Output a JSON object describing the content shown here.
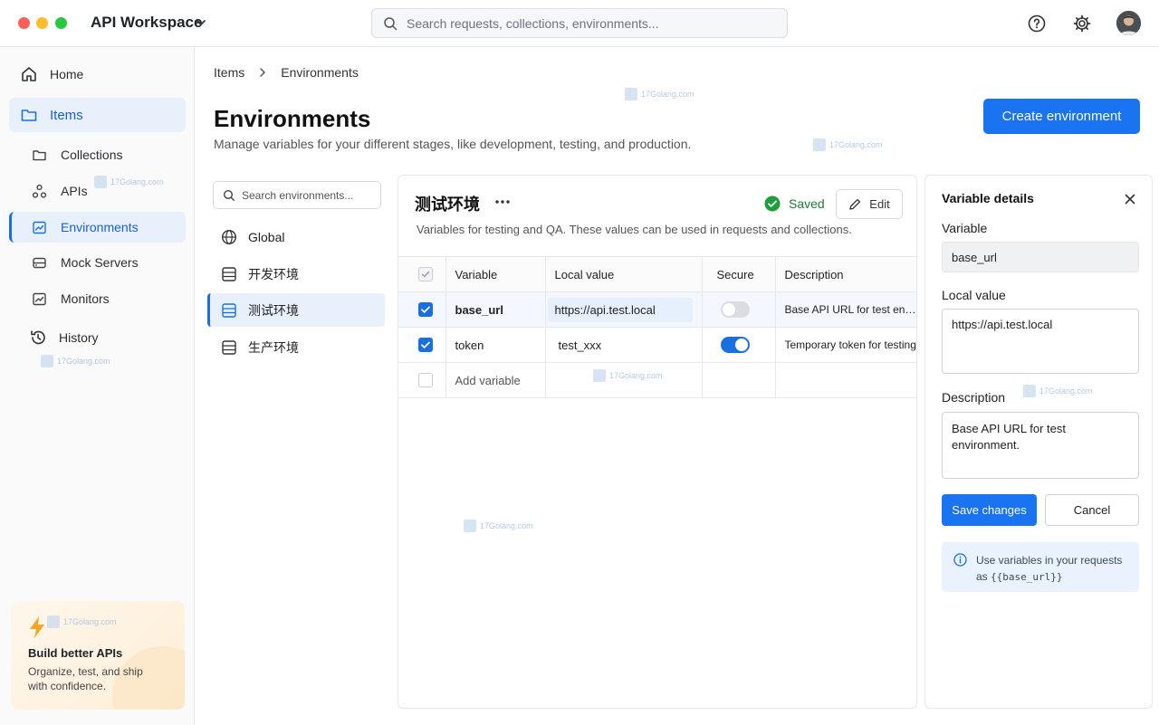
{
  "topbar": {
    "workspace_title": "API Workspace",
    "search_placeholder": "Search requests, collections, environments..."
  },
  "sidebar": {
    "home": "Home",
    "items": "Items",
    "sub_items": [
      "Collections",
      "APIs",
      "Environments",
      "Mock Servers",
      "Monitors"
    ],
    "history": "History",
    "promo": {
      "title": "Build better APIs",
      "text": "Organize, test, and ship with confidence."
    }
  },
  "breadcrumb": [
    "Items",
    "Environments"
  ],
  "page": {
    "title": "Environments",
    "subtitle": "Manage variables for your different stages, like development, testing, and production.",
    "create_button": "Create environment"
  },
  "env_list": {
    "search_placeholder": "Search environments...",
    "items": [
      "Global",
      "开发环境",
      "测试环境",
      "生产环境"
    ],
    "active_index": 2
  },
  "env_card": {
    "name": "测试环境",
    "status": "Saved",
    "edit_label": "Edit",
    "description": "Variables for testing and QA. These values can be used in requests and collections.",
    "columns": [
      "Variable",
      "Local value",
      "Secure",
      "Description"
    ],
    "rows": [
      {
        "checked": true,
        "variable": "base_url",
        "value": "https://api.test.local",
        "secure": false,
        "description": "Base API URL for test environment."
      },
      {
        "checked": true,
        "variable": "token",
        "value": "test_xxx",
        "secure": true,
        "description": "Temporary token for testing"
      }
    ],
    "add_variable": "Add variable"
  },
  "details": {
    "title": "Variable details",
    "variable_label": "Variable",
    "variable_value": "base_url",
    "local_label": "Local value",
    "local_value": "https://api.test.local",
    "description_label": "Description",
    "description_value": "Base API URL for test environment.",
    "save_label": "Save changes",
    "cancel_label": "Cancel",
    "hint_text": "Use variables in your requests as",
    "hint_code": "{{base_url}}"
  },
  "watermark": "17Golang.com",
  "colors": {
    "accent": "#1a73f0",
    "active_bg": "#e8f0fc",
    "saved_green": "#1f9d3c"
  }
}
